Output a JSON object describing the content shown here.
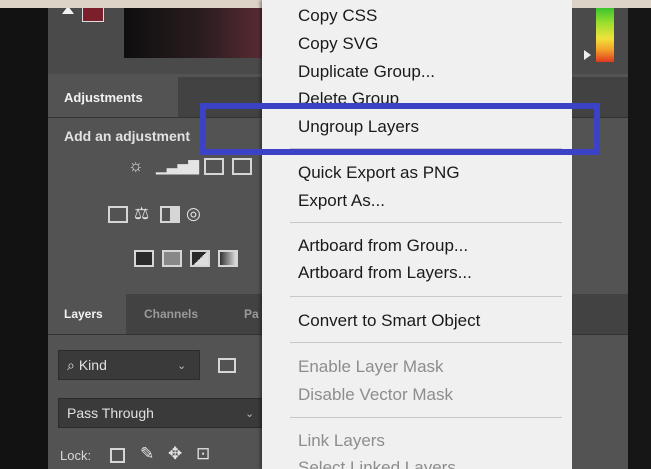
{
  "color_panel": {
    "fg_swatch_color": "#7a1f2b"
  },
  "adjustments": {
    "tab_label": "Adjustments",
    "add_label": "Add an adjustment",
    "icons": [
      "brightness-contrast-icon",
      "levels-icon",
      "curves-icon",
      "exposure-icon",
      "vibrance-icon",
      "hue-saturation-icon",
      "color-balance-icon",
      "black-white-icon",
      "photo-filter-icon",
      "invert-icon",
      "posterize-icon",
      "threshold-icon",
      "gradient-map-icon"
    ]
  },
  "layers": {
    "tabs": [
      "Layers",
      "Channels",
      "Pa"
    ],
    "kind_label": "Kind",
    "blend_mode": "Pass Through",
    "lock_label": "Lock:"
  },
  "menu": {
    "items": [
      {
        "label": "Copy CSS",
        "enabled": true
      },
      {
        "label": "Copy SVG",
        "enabled": true
      },
      {
        "label": "Duplicate Group...",
        "enabled": true
      },
      {
        "label": "Delete Group",
        "enabled": true
      },
      {
        "label": "Ungroup Layers",
        "enabled": true
      },
      {
        "label": "Quick Export as PNG",
        "enabled": true
      },
      {
        "label": "Export As...",
        "enabled": true
      },
      {
        "label": "Artboard from Group...",
        "enabled": true
      },
      {
        "label": "Artboard from Layers...",
        "enabled": true
      },
      {
        "label": "Convert to Smart Object",
        "enabled": true
      },
      {
        "label": "Enable Layer Mask",
        "enabled": false
      },
      {
        "label": "Disable Vector Mask",
        "enabled": false
      },
      {
        "label": "Link Layers",
        "enabled": false
      },
      {
        "label": "Select Linked Layers",
        "enabled": false
      }
    ],
    "highlighted_item": "Ungroup Layers",
    "highlight_color": "#3b42c5"
  }
}
